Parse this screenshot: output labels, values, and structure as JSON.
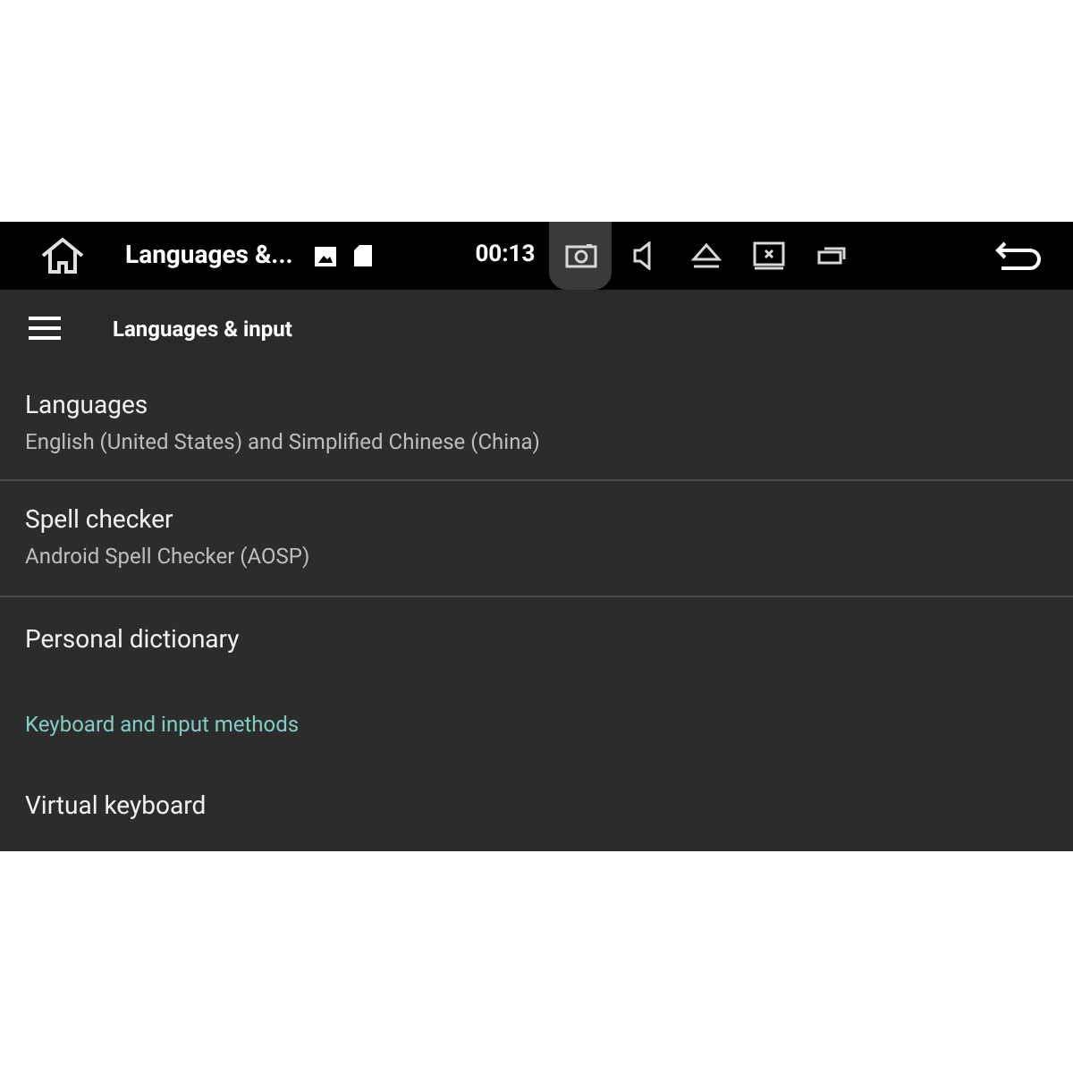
{
  "status_bar": {
    "title": "Languages &...",
    "time": "00:13",
    "buttons": [
      {
        "kind": "screenshot",
        "selected": true
      },
      {
        "kind": "volume",
        "selected": false
      },
      {
        "kind": "eject",
        "selected": false
      },
      {
        "kind": "screen-off",
        "selected": false
      },
      {
        "kind": "recents",
        "selected": false
      }
    ]
  },
  "toolbar": {
    "title": "Languages & input"
  },
  "items": [
    {
      "kind": "preference",
      "title": "Languages",
      "summary": "English (United States) and Simplified Chinese (China)"
    },
    {
      "kind": "preference",
      "title": "Spell checker",
      "summary": "Android Spell Checker (AOSP)"
    },
    {
      "kind": "preference",
      "title": "Personal dictionary"
    },
    {
      "kind": "category",
      "title": "Keyboard and input methods"
    },
    {
      "kind": "preference",
      "title": "Virtual keyboard"
    }
  ]
}
